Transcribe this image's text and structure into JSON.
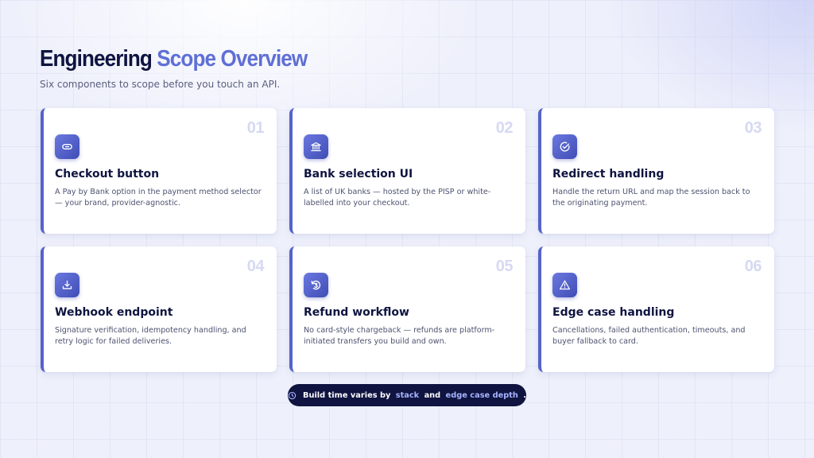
{
  "header": {
    "title_part1": "Engineering",
    "title_part2": "Scope Overview",
    "subtitle": "Six components to scope before you touch an API."
  },
  "cards": [
    {
      "number": "01",
      "icon": "link-icon",
      "title": "Checkout button",
      "description": "A Pay by Bank option in the payment method selector — your brand, provider-agnostic."
    },
    {
      "number": "02",
      "icon": "bank-icon",
      "title": "Bank selection UI",
      "description": "A list of UK banks — hosted by the PISP or white-labelled into your checkout."
    },
    {
      "number": "03",
      "icon": "check-circle-icon",
      "title": "Redirect handling",
      "description": "Handle the return URL and map the session back to the originating payment."
    },
    {
      "number": "04",
      "icon": "download-icon",
      "title": "Webhook endpoint",
      "description": "Signature verification, idempotency handling, and retry logic for failed deliveries."
    },
    {
      "number": "05",
      "icon": "refund-icon",
      "title": "Refund workflow",
      "description": "No card-style chargeback — refunds are platform-initiated transfers you build and own."
    },
    {
      "number": "06",
      "icon": "warning-icon",
      "title": "Edge case handling",
      "description": "Cancellations, failed authentication, timeouts, and buyer fallback to card."
    }
  ],
  "footer_note": {
    "icon": "clock-icon",
    "prefix": "Build time varies by",
    "highlight1": "stack",
    "connector": "and",
    "highlight2": "edge case depth",
    "suffix": "."
  },
  "colors": {
    "accent": "#5f6fd6",
    "accent_dark": "#3f4db5",
    "navy": "#0f1440",
    "highlight": "#a9b3ff"
  }
}
